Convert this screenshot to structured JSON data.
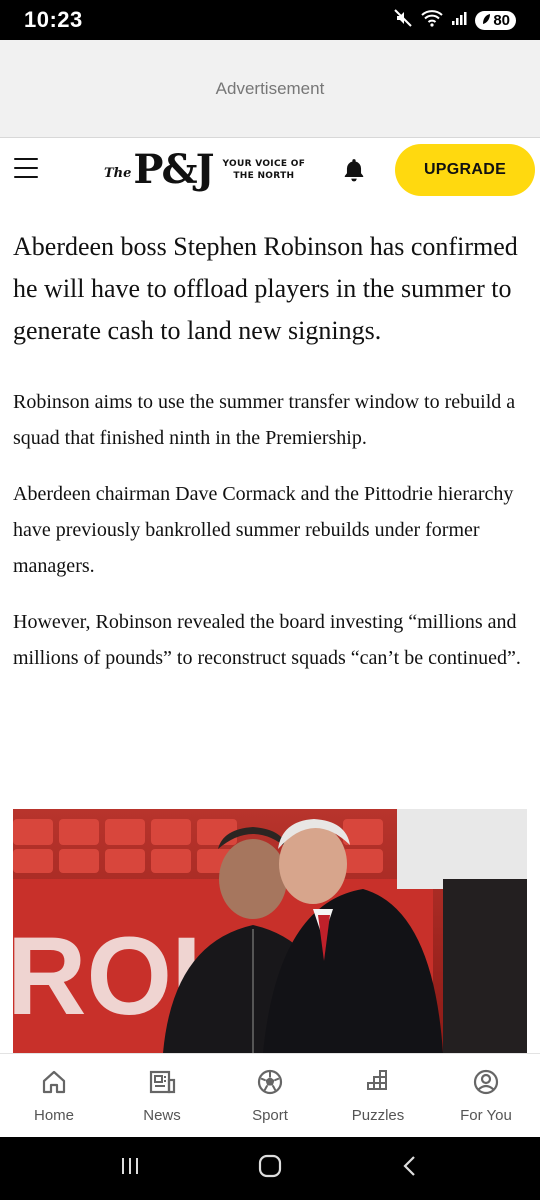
{
  "status_bar": {
    "time": "10:23",
    "battery": "80"
  },
  "ad": {
    "label": "Advertisement"
  },
  "header": {
    "logo_the": "The",
    "logo_mark": "P&J",
    "tagline_line1": "YOUR VOICE OF",
    "tagline_line2": "THE NORTH",
    "upgrade_label": "UPGRADE",
    "accent_color": "#ffd90f"
  },
  "article": {
    "lede": "Aberdeen boss Stephen Robinson has confirmed he will have to offload players in the summer to generate cash to land new signings.",
    "paragraphs": [
      "Robinson aims to use the summer transfer window to rebuild a squad that finished ninth in the Premiership.",
      "Aberdeen chairman Dave Cormack and the Pittodrie hierarchy have previously bankrolled summer rebuilds under former managers.",
      "However, Robinson revealed the board investing “millions and millions of pounds” to reconstruct squads “can’t be continued”."
    ],
    "photo_text": "ROU"
  },
  "bottom_nav": {
    "items": [
      {
        "label": "Home",
        "icon": "home-icon"
      },
      {
        "label": "News",
        "icon": "news-icon"
      },
      {
        "label": "Sport",
        "icon": "football-icon"
      },
      {
        "label": "Puzzles",
        "icon": "puzzle-icon"
      },
      {
        "label": "For You",
        "icon": "user-circle-icon"
      }
    ]
  }
}
